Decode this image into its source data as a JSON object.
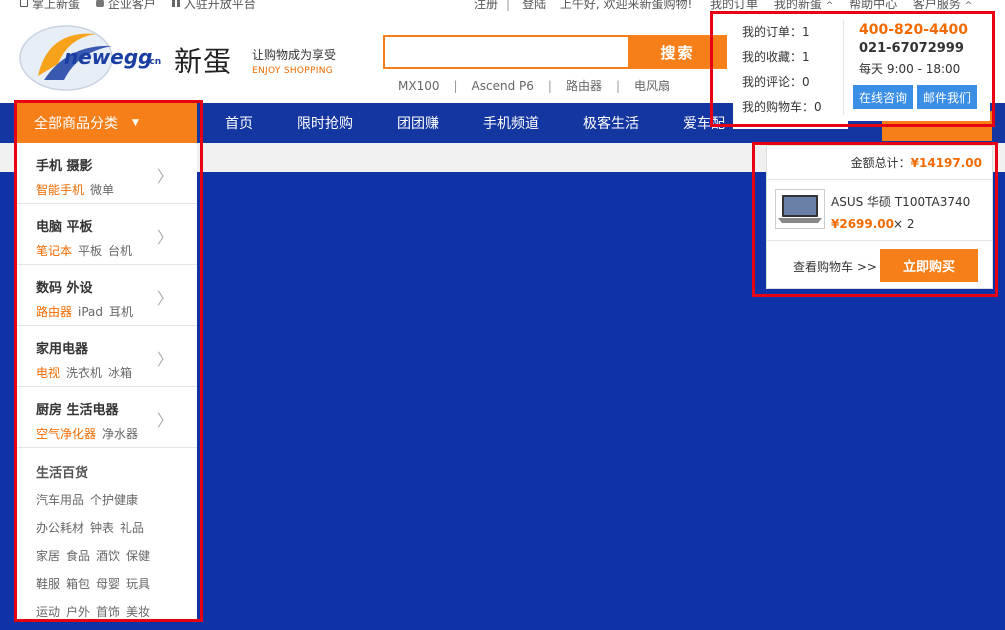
{
  "topbar": {
    "left_items": [
      {
        "label": "掌上新蛋",
        "icon": "phone-icon"
      },
      {
        "label": "企业客户",
        "icon": "user-icon"
      },
      {
        "label": "入驻开放平台",
        "icon": "grid-icon"
      }
    ],
    "register": "注册",
    "login": "登陆",
    "greeting": "上午好, 欢迎来新蛋购物!",
    "my_orders": "我的订单",
    "my_newegg": "我的新蛋",
    "help_center": "帮助中心",
    "customer_service": "客户服务"
  },
  "logo": {
    "text": "newegg",
    "suffix": ".cn",
    "brand_cn": "新蛋"
  },
  "slogan": {
    "cn": "让购物成为享受",
    "en": "ENJOY SHOPPING"
  },
  "search": {
    "placeholder": "",
    "button": "搜索"
  },
  "hotwords": [
    "MX100",
    "Ascend P6",
    "路由器",
    "电风扇"
  ],
  "nav": {
    "all_categories": "全部商品分类",
    "items": [
      "首页",
      "限时抢购",
      "团团赚",
      "手机频道",
      "极客生活",
      "爱车配"
    ]
  },
  "categories": [
    {
      "title": "手机  摄影",
      "subs": [
        "智能手机",
        "微单"
      ]
    },
    {
      "title": "电脑  平板",
      "subs": [
        "笔记本",
        "平板",
        "台机"
      ]
    },
    {
      "title": "数码  外设",
      "subs": [
        "路由器",
        "iPad",
        "耳机"
      ]
    },
    {
      "title": "家用电器",
      "subs": [
        "电视",
        "洗衣机",
        "冰箱"
      ]
    },
    {
      "title": "厨房  生活电器",
      "subs": [
        "空气净化器",
        "净水器"
      ]
    }
  ],
  "life": {
    "title": "生活百货",
    "lines": [
      [
        "汽车用品",
        "个护健康"
      ],
      [
        "办公耗材",
        "钟表",
        "礼品"
      ],
      [
        "家居",
        "食品",
        "酒饮",
        "保健"
      ],
      [
        "鞋服",
        "箱包",
        "母婴",
        "玩具"
      ],
      [
        "运动",
        "户外",
        "首饰",
        "美妆"
      ]
    ]
  },
  "account_dropdown": {
    "my_orders": "我的订单：1",
    "my_favorites": "我的收藏：1",
    "my_reviews": "我的评论：0",
    "my_cart": "我的购物车：0",
    "hotline": "400-820-4400",
    "phone": "021-67072999",
    "hours": "每天 9:00 - 18:00",
    "online_consult": "在线咨询",
    "email_us": "邮件我们"
  },
  "cart": {
    "total_label": "金额总计：",
    "total_value": "¥14197.00",
    "product_name": "ASUS 华硕 T100TA3740",
    "product_price": "¥2699.00",
    "product_qty": "× 2",
    "view_cart": "查看购物车 >>",
    "buy_now": "立即购买"
  },
  "colors": {
    "accent": "#f77f1a",
    "nav_blue": "#1436a0",
    "banner_blue": "#0f33a6",
    "highlight": "#e60012"
  }
}
